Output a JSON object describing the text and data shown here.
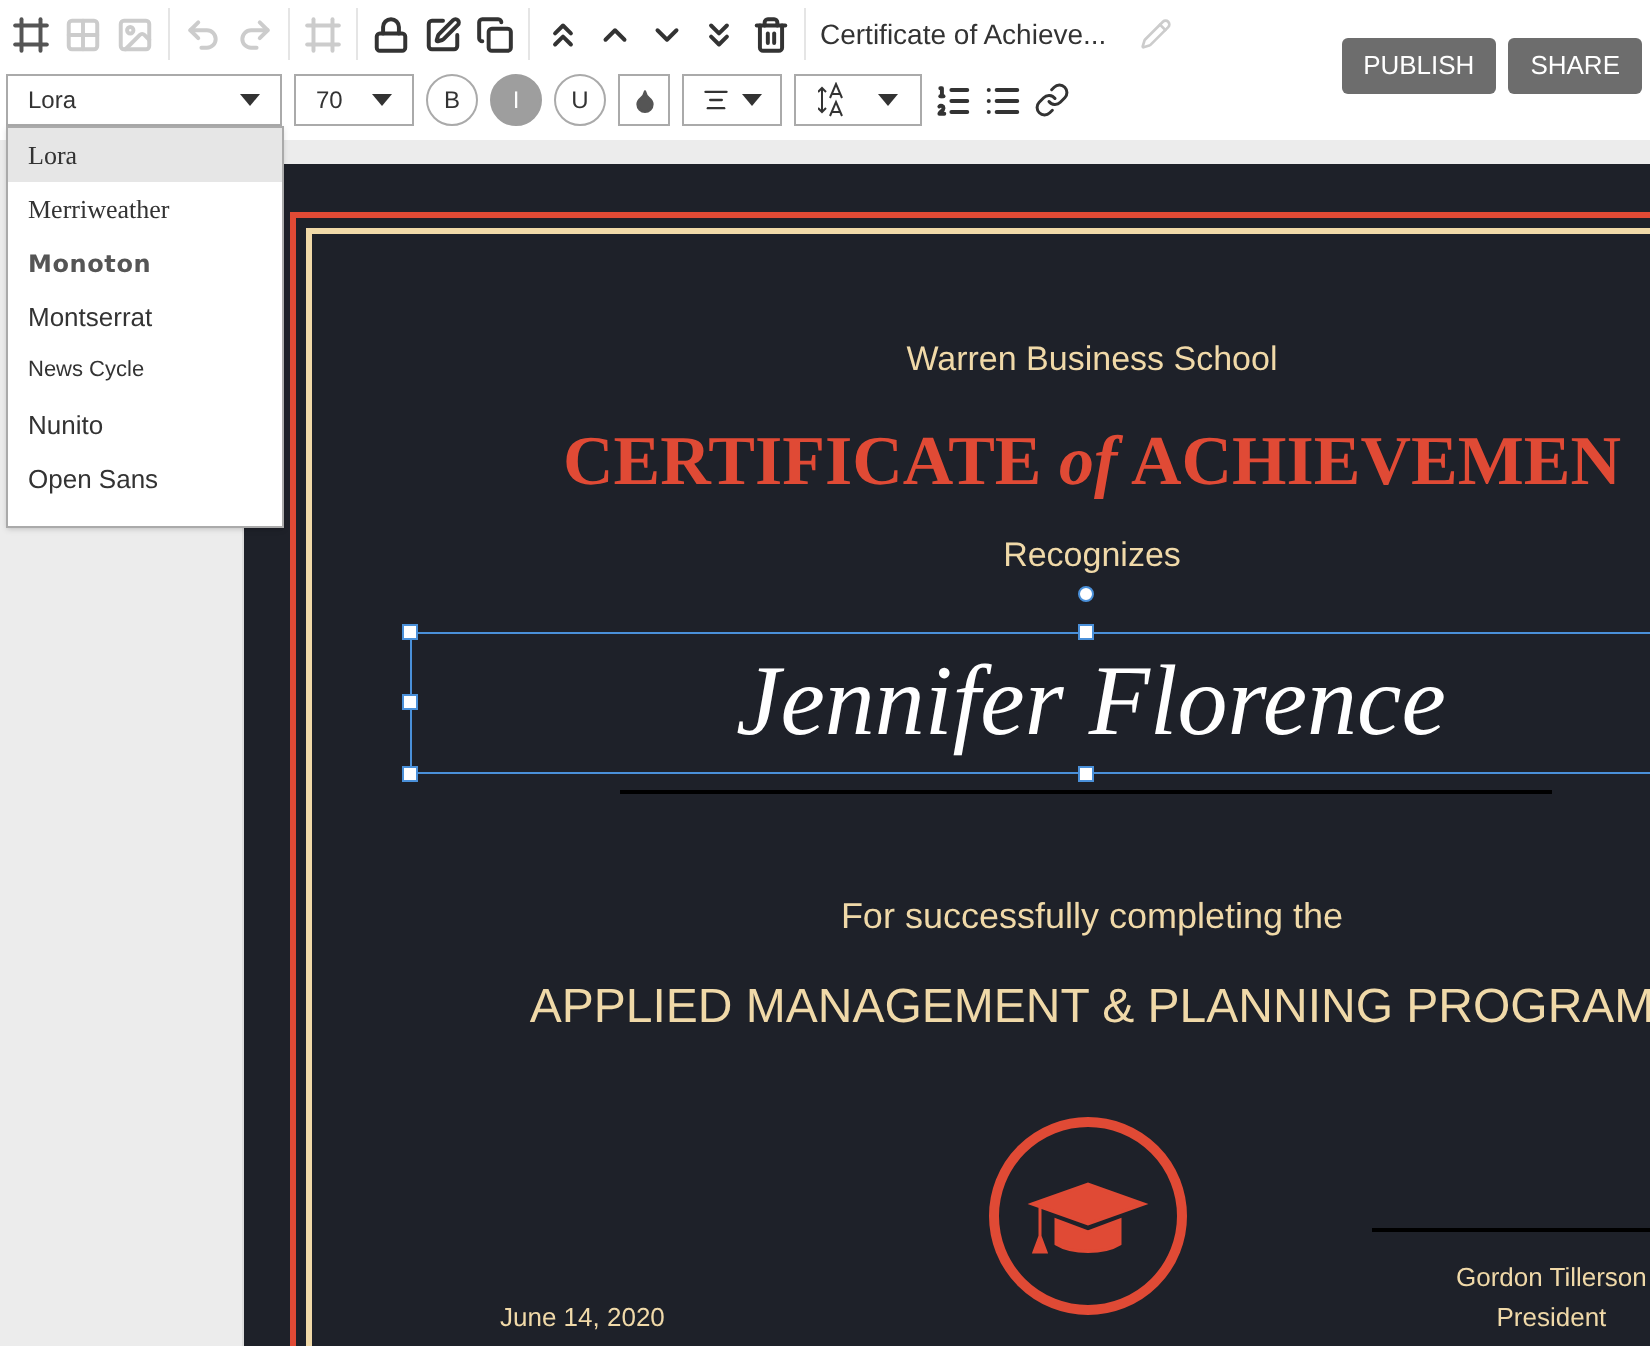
{
  "toolbar": {
    "document_title": "Certificate of Achieve...",
    "buttons": [
      "PUBLISH",
      "SHARE"
    ]
  },
  "format_bar": {
    "font": "Lora",
    "font_size": "70",
    "styles": [
      {
        "label": "B",
        "selected": false
      },
      {
        "label": "I",
        "selected": true
      },
      {
        "label": "U",
        "selected": false
      }
    ]
  },
  "font_menu": [
    {
      "label": "Lora",
      "kind": "serif",
      "selected": true
    },
    {
      "label": "Merriweather",
      "kind": "serif",
      "selected": false
    },
    {
      "label": "Monoton",
      "kind": "display",
      "selected": false
    },
    {
      "label": "Montserrat",
      "kind": "sans",
      "selected": false
    },
    {
      "label": "News Cycle",
      "kind": "small",
      "selected": false
    },
    {
      "label": "Nunito",
      "kind": "sans",
      "selected": false
    },
    {
      "label": "Open Sans",
      "kind": "sans",
      "selected": false
    }
  ],
  "certificate": {
    "school": "Warren Business School",
    "title": "CERTIFICATE *of* ACHIEVEMEN",
    "recognizes": "Recognizes",
    "name": "Jennifer Florence",
    "completing": "For successfully completing the",
    "program": "APPLIED MANAGEMENT & PLANNING PROGRAM",
    "date": "June 14, 2020",
    "signer": "Gordon Tillerson",
    "signer_role": "President"
  }
}
